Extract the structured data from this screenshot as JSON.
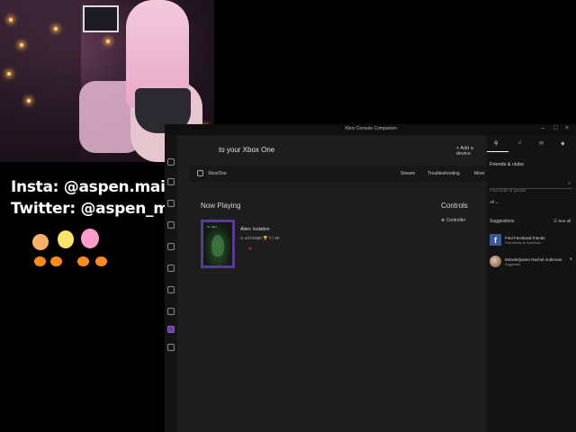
{
  "overlay": {
    "insta": "Insta: @aspen.mai",
    "twitter": "Twitter: @aspen_mai"
  },
  "window": {
    "title": "Xbox Console Companion",
    "minimize": "–",
    "maximize": "□",
    "close": "×"
  },
  "header": {
    "title": "to your Xbox One",
    "add_device": "+ Add a device"
  },
  "toolbar": {
    "device": "XboxOne",
    "stream": "Stream",
    "troubleshoot": "Troubleshooting",
    "more": "More"
  },
  "now_playing": {
    "title": "Now Playing",
    "game_name": "Alien: Isolation",
    "gamerscore": "⊙ 427/1000",
    "achievements": "🏆 7 / 45",
    "boxart_logo": "ALIEN"
  },
  "controls": {
    "title": "Controls",
    "item": "⊕ Controller"
  },
  "friends": {
    "heading": "Friends & clubs",
    "search_placeholder": "Find clubs or people",
    "filter": "All ⌄",
    "suggestions_title": "Suggestions",
    "see_all": "☰ See all",
    "suggestions": [
      {
        "name": "Find Facebook friends",
        "sub": "Find friends on Facebook"
      },
      {
        "name": "MiracleQueen Rachel Anderson",
        "sub": "Suggested"
      }
    ]
  },
  "colors": {
    "accent": "#6b3fa0",
    "facebook": "#3b5998"
  }
}
